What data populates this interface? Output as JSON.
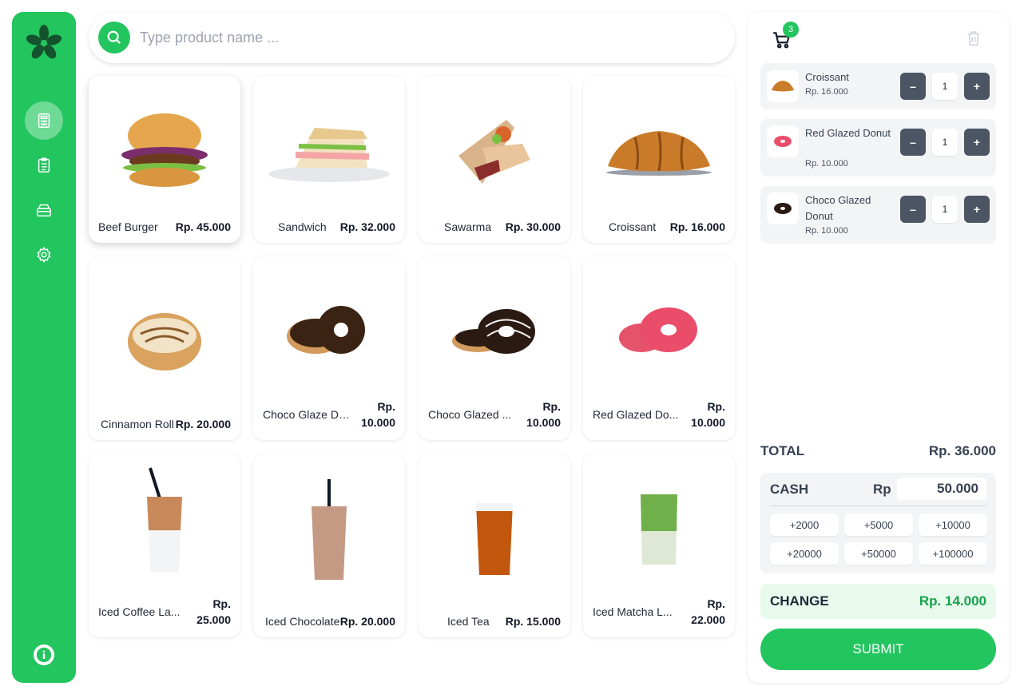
{
  "colors": {
    "accent": "#22c55e",
    "qty_button": "#4b5563",
    "change_value": "#16a34a",
    "change_bg": "#e8f9ee"
  },
  "sidebar": {
    "logo": "flower-logo",
    "items": [
      {
        "icon": "calculator-icon",
        "active": true
      },
      {
        "icon": "clipboard-icon",
        "active": false
      },
      {
        "icon": "archive-box-icon",
        "active": false
      },
      {
        "icon": "gear-icon",
        "active": false
      }
    ],
    "footer_icon": "info-icon"
  },
  "search": {
    "placeholder": "Type product name ..."
  },
  "products": [
    {
      "name": "Beef Burger",
      "price": "Rp. 45.000"
    },
    {
      "name": "Sandwich",
      "price": "Rp. 32.000"
    },
    {
      "name": "Sawarma",
      "price": "Rp. 30.000"
    },
    {
      "name": "Croissant",
      "price": "Rp. 16.000"
    },
    {
      "name": "Cinnamon Roll",
      "price": "Rp. 20.000"
    },
    {
      "name": "Choco Glaze Don...",
      "price": "Rp. 10.000"
    },
    {
      "name": "Choco Glazed ...",
      "price": "Rp. 10.000"
    },
    {
      "name": "Red Glazed Do...",
      "price": "Rp. 10.000"
    },
    {
      "name": "Iced Coffee La...",
      "price": "Rp. 25.000"
    },
    {
      "name": "Iced Chocolate",
      "price": "Rp. 20.000"
    },
    {
      "name": "Iced Tea",
      "price": "Rp. 15.000"
    },
    {
      "name": "Iced Matcha L...",
      "price": "Rp. 22.000"
    }
  ],
  "cart": {
    "count": "3",
    "items": [
      {
        "name": "Croissant",
        "price": "Rp. 16.000",
        "qty": "1",
        "minus": "–",
        "plus": "+"
      },
      {
        "name": "Red Glazed Donut",
        "price": "Rp. 10.000",
        "qty": "1",
        "minus": "–",
        "plus": "+"
      },
      {
        "name": "Choco Glazed Donut",
        "price": "Rp. 10.000",
        "qty": "1",
        "minus": "–",
        "plus": "+"
      }
    ],
    "total_label": "TOTAL",
    "total_value": "Rp. 36.000",
    "cash_label": "CASH",
    "cash_currency": "Rp",
    "cash_value": "50.000",
    "quick_amounts": [
      "+2000",
      "+5000",
      "+10000",
      "+20000",
      "+50000",
      "+100000"
    ],
    "change_label": "CHANGE",
    "change_value": "Rp. 14.000",
    "submit_label": "SUBMIT"
  }
}
